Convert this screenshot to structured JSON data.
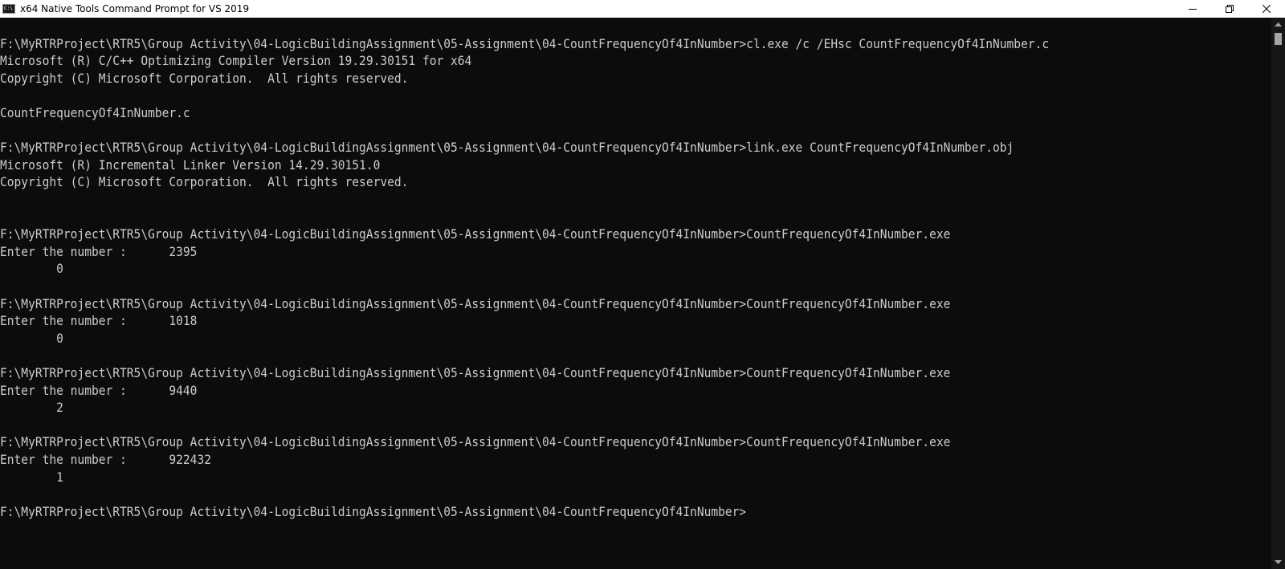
{
  "window": {
    "title": "x64 Native Tools Command Prompt for VS 2019",
    "icon_label": "C:\\"
  },
  "controls": {
    "minimize": "minimize-icon",
    "restore": "restore-icon",
    "close": "close-icon"
  },
  "colors": {
    "background": "#0c0c0c",
    "foreground": "#cccccc",
    "titlebar": "#ffffff"
  },
  "console": {
    "lines": [
      "",
      "F:\\MyRTRProject\\RTR5\\Group Activity\\04-LogicBuildingAssignment\\05-Assignment\\04-CountFrequencyOf4InNumber>cl.exe /c /EHsc CountFrequencyOf4InNumber.c",
      "Microsoft (R) C/C++ Optimizing Compiler Version 19.29.30151 for x64",
      "Copyright (C) Microsoft Corporation.  All rights reserved.",
      "",
      "CountFrequencyOf4InNumber.c",
      "",
      "F:\\MyRTRProject\\RTR5\\Group Activity\\04-LogicBuildingAssignment\\05-Assignment\\04-CountFrequencyOf4InNumber>link.exe CountFrequencyOf4InNumber.obj",
      "Microsoft (R) Incremental Linker Version 14.29.30151.0",
      "Copyright (C) Microsoft Corporation.  All rights reserved.",
      "",
      "",
      "F:\\MyRTRProject\\RTR5\\Group Activity\\04-LogicBuildingAssignment\\05-Assignment\\04-CountFrequencyOf4InNumber>CountFrequencyOf4InNumber.exe",
      "Enter the number :      2395",
      "        0",
      "",
      "F:\\MyRTRProject\\RTR5\\Group Activity\\04-LogicBuildingAssignment\\05-Assignment\\04-CountFrequencyOf4InNumber>CountFrequencyOf4InNumber.exe",
      "Enter the number :      1018",
      "        0",
      "",
      "F:\\MyRTRProject\\RTR5\\Group Activity\\04-LogicBuildingAssignment\\05-Assignment\\04-CountFrequencyOf4InNumber>CountFrequencyOf4InNumber.exe",
      "Enter the number :      9440",
      "        2",
      "",
      "F:\\MyRTRProject\\RTR5\\Group Activity\\04-LogicBuildingAssignment\\05-Assignment\\04-CountFrequencyOf4InNumber>CountFrequencyOf4InNumber.exe",
      "Enter the number :      922432",
      "        1",
      "",
      "F:\\MyRTRProject\\RTR5\\Group Activity\\04-LogicBuildingAssignment\\05-Assignment\\04-CountFrequencyOf4InNumber>"
    ]
  }
}
